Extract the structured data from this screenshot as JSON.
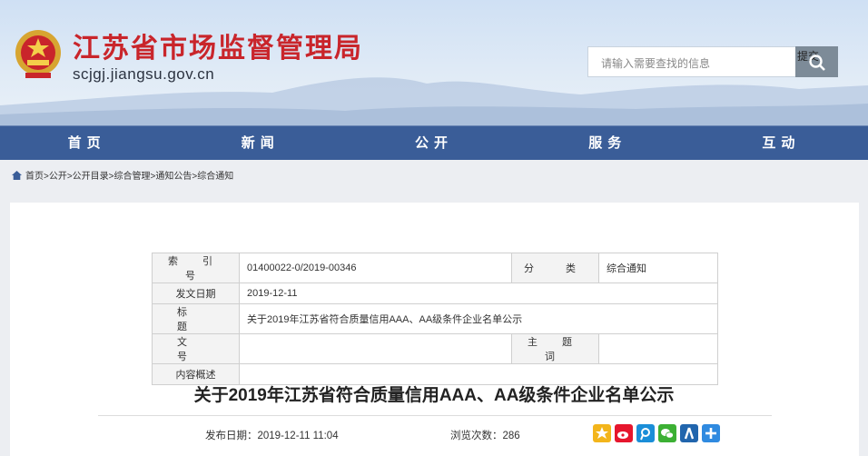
{
  "header": {
    "title": "江苏省市场监督管理局",
    "url": "scjgj.jiangsu.gov.cn",
    "search_placeholder": "请输入需要查找的信息",
    "search_button": "提交"
  },
  "nav": [
    "首页",
    "新闻",
    "公开",
    "服务",
    "互动"
  ],
  "breadcrumb": "首页>公开>公开目录>综合管理>通知公告>综合通知",
  "info": {
    "index_label": "索 引 号",
    "index_value": "01400022-0/2019-00346",
    "category_label": "分　类",
    "category_value": "综合通知",
    "date_label": "发文日期",
    "date_value": "2019-12-11",
    "title_label": "标 题",
    "title_value": "关于2019年江苏省符合质量信用AAA、AA级条件企业名单公示",
    "docno_label": "文 号",
    "docno_value": "",
    "keywords_label": "主 题 词",
    "keywords_value": "",
    "summary_label": "内容概述",
    "summary_value": ""
  },
  "article": {
    "title": "关于2019年江苏省符合质量信用AAA、AA级条件企业名单公示",
    "publish": "发布日期：2019-12-11 11:04",
    "views": "浏览次数：286"
  },
  "share_icons": [
    "qzone-icon",
    "weibo-icon",
    "tencent-weibo-icon",
    "wechat-icon",
    "renren-icon",
    "more-share-icon"
  ],
  "colors": {
    "brand_red": "#c9252b",
    "nav_blue": "#3a5d98"
  }
}
